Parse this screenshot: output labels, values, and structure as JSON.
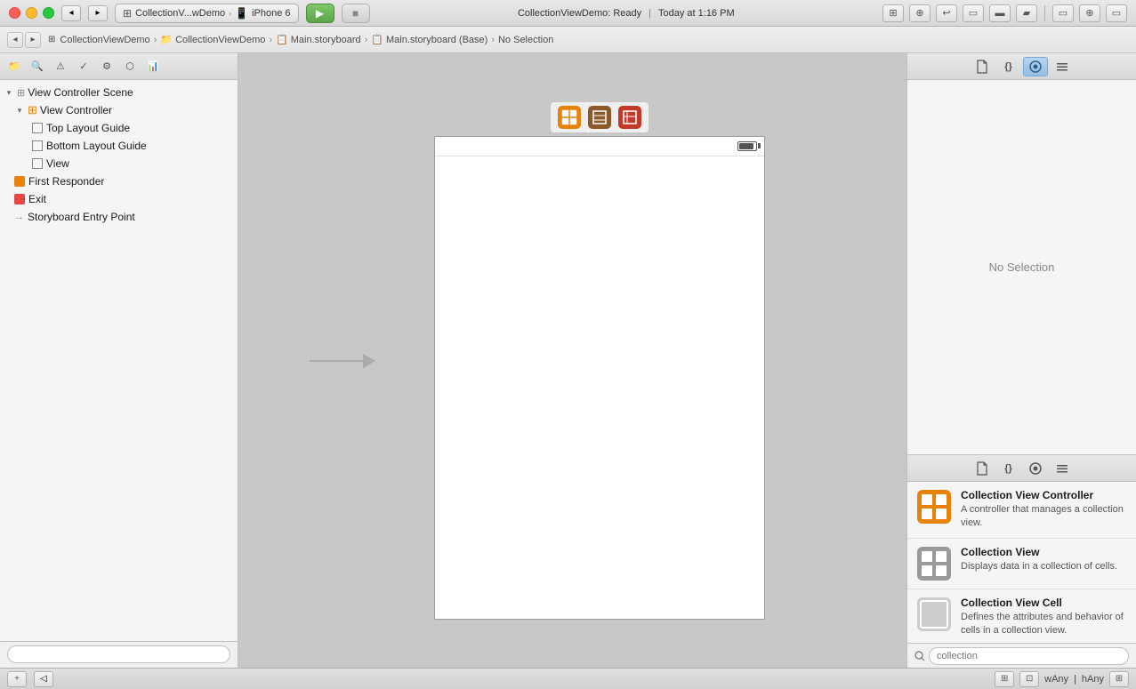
{
  "titlebar": {
    "app_name": "CollectionV...wDemo",
    "device": "iPhone 6",
    "status": "CollectionViewDemo: Ready",
    "time": "Today at 1:16 PM",
    "run_label": "▶",
    "stop_label": "■"
  },
  "breadcrumb": {
    "items": [
      {
        "label": "CollectionViewDemo",
        "icon": "folder",
        "type": "project"
      },
      {
        "label": "CollectionViewDemo",
        "icon": "folder",
        "type": "folder"
      },
      {
        "label": "Main.storyboard",
        "icon": "storyboard",
        "type": "storyboard"
      },
      {
        "label": "Main.storyboard (Base)",
        "icon": "storyboard",
        "type": "storyboard"
      },
      {
        "label": "No Selection",
        "type": "text"
      }
    ]
  },
  "navigator": {
    "search_placeholder": "",
    "tree": {
      "scene_label": "View Controller Scene",
      "controller_label": "View Controller",
      "top_layout_guide": "Top Layout Guide",
      "bottom_layout_guide": "Bottom Layout Guide",
      "view_label": "View",
      "first_responder": "First Responder",
      "exit_label": "Exit",
      "storyboard_entry_point": "Storyboard Entry Point"
    }
  },
  "canvas": {
    "scene_icons": [
      "⊞",
      "⊟",
      "≡"
    ],
    "battery_text": "▮▮▮",
    "entry_point_label": "Storyboard Entry Point"
  },
  "inspector": {
    "no_selection": "No Selection",
    "tabs": [
      {
        "icon": "📄",
        "label": "file-tab"
      },
      {
        "icon": "{}",
        "label": "quick-help-tab"
      },
      {
        "icon": "◎",
        "label": "identity-tab",
        "active": true
      },
      {
        "icon": "≡",
        "label": "attributes-tab"
      }
    ],
    "bottom_tabs": [
      {
        "icon": "📄",
        "label": "file-tab-bottom"
      },
      {
        "icon": "{}",
        "label": "code-tab-bottom"
      },
      {
        "icon": "◎",
        "label": "circle-tab-bottom"
      },
      {
        "icon": "≡",
        "label": "list-tab-bottom"
      }
    ],
    "library_items": [
      {
        "title": "Collection View Controller",
        "description": "A controller that manages a collection view.",
        "icon_type": "orange_grid"
      },
      {
        "title": "Collection View",
        "description": "Displays data in a collection of cells.",
        "icon_type": "gray_grid"
      },
      {
        "title": "Collection View Cell",
        "description": "Defines the attributes and behavior of cells in a collection view.",
        "icon_type": "light_grid"
      }
    ],
    "library_search_placeholder": "collection"
  },
  "bottom_bar": {
    "w_size_class": "wAny",
    "h_size_class": "hAny",
    "size_separator": "|"
  }
}
